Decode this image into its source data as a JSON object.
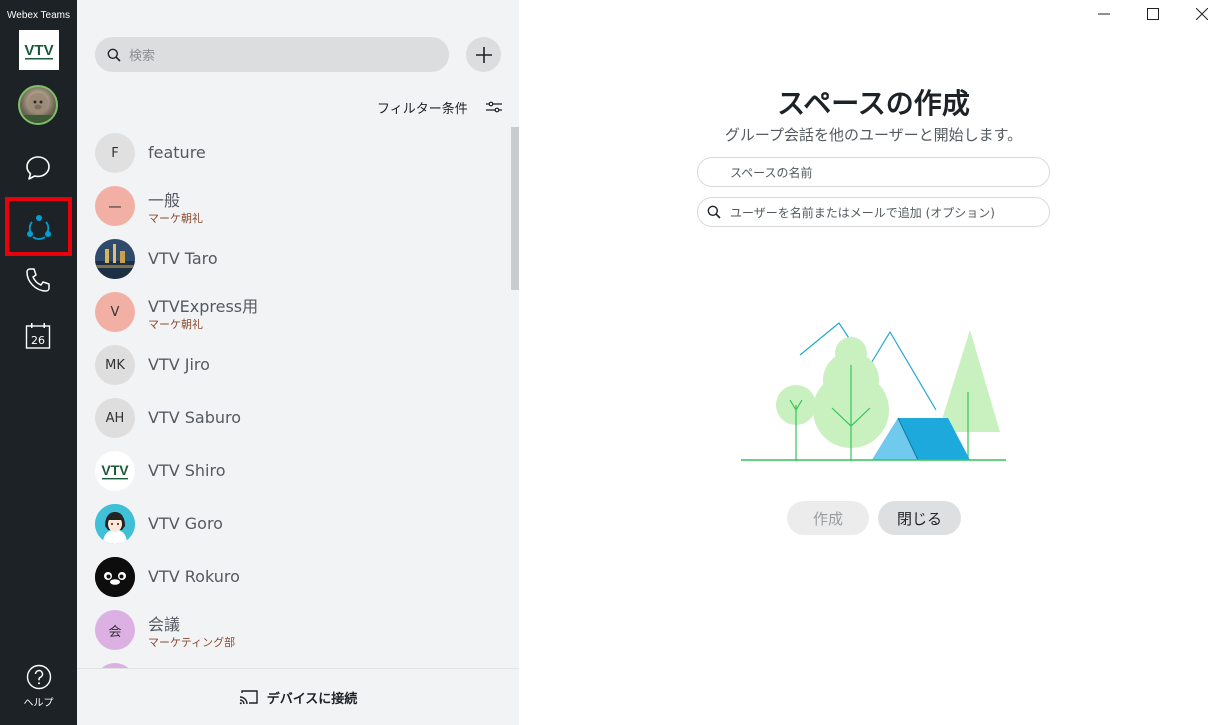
{
  "app": {
    "title": "Webex Teams"
  },
  "brand": {
    "logo_text": "VTV",
    "accent": "#1a5a3a"
  },
  "nav": {
    "items": [
      {
        "name": "messaging",
        "icon": "chat-bubble-icon"
      },
      {
        "name": "teams",
        "icon": "teams-icon",
        "selected": true
      },
      {
        "name": "calls",
        "icon": "phone-icon"
      },
      {
        "name": "meetings",
        "icon": "calendar-icon",
        "badge": "26"
      }
    ],
    "help_label": "ヘルプ"
  },
  "panel": {
    "search_placeholder": "検索",
    "filter_label": "フィルター条件",
    "connect_label": "デバイスに接続",
    "spaces": [
      {
        "name": "feature",
        "initials": "F",
        "color": "#e0e0e0"
      },
      {
        "name": "一般",
        "subtitle": "マーケ朝礼",
        "initials": "一",
        "color": "#f2b0a4"
      },
      {
        "name": "VTV Taro",
        "avatar": "photo"
      },
      {
        "name": "VTVExpress用",
        "subtitle": "マーケ朝礼",
        "initials": "V",
        "color": "#f2b0a4"
      },
      {
        "name": "VTV Jiro",
        "initials": "MK",
        "color": "#dedede"
      },
      {
        "name": "VTV Saburo",
        "initials": "AH",
        "color": "#dedede"
      },
      {
        "name": "VTV Shiro",
        "avatar": "vtv-logo"
      },
      {
        "name": "VTV Goro",
        "avatar": "girl"
      },
      {
        "name": "VTV Rokuro",
        "avatar": "penguin"
      },
      {
        "name": "会議",
        "subtitle": "マーケティング部",
        "initials": "会",
        "color": "#dcb0e2"
      }
    ]
  },
  "create_space": {
    "title": "スペースの作成",
    "subtitle": "グループ会話を他のユーザーと開始します。",
    "name_placeholder": "スペースの名前",
    "users_placeholder": "ユーザーを名前またはメールで追加 (オプション)",
    "create_button": "作成",
    "close_button": "閉じる"
  }
}
